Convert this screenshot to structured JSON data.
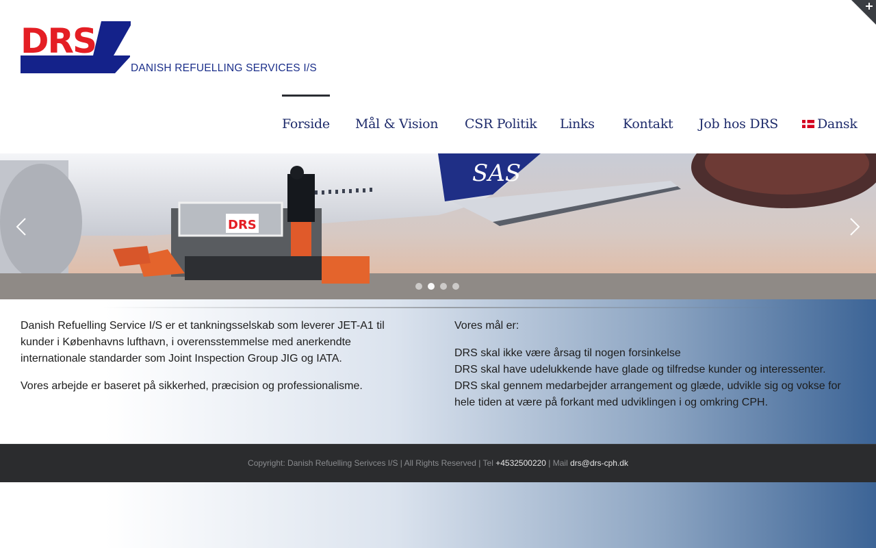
{
  "brand": {
    "logo_text": "DRS",
    "subtitle": "DANISH REFUELLING SERVICES I/S",
    "colors": {
      "red": "#e41e24",
      "navy": "#14228a"
    }
  },
  "nav": {
    "items": [
      {
        "label": "Forside",
        "active": true
      },
      {
        "label": "Mål & Vision"
      },
      {
        "label": "CSR Politik"
      },
      {
        "label": "Links"
      },
      {
        "label": "Kontakt"
      },
      {
        "label": "Job hos DRS"
      },
      {
        "label": "Dansk",
        "icon": "danish-flag-icon"
      }
    ]
  },
  "slider": {
    "image_text": "SAS",
    "truck_label": "DRS",
    "prev_icon": "chevron-left-icon",
    "next_icon": "chevron-right-icon",
    "slide_count": 4,
    "active_slide": 2
  },
  "content": {
    "left": {
      "p1": "Danish Refuelling Service I/S er et tankningsselskab  som leverer JET-A1 til kunder i Københavns lufthavn, i overensstemmelse med anerkendte internationale standarder som Joint Inspection Group JIG og IATA.",
      "p2": "Vores arbejde er baseret på sikkerhed, præcision og professionalisme."
    },
    "right": {
      "heading": "Vores mål er:",
      "line1": "DRS skal ikke være årsag til nogen forsinkelse",
      "line2": "DRS skal have udelukkende have glade og tilfredse kunder og interessenter.",
      "line3": "DRS skal gennem medarbejder arrangement og glæde, udvikle sig og vokse for hele tiden at være på forkant med udviklingen i og omkring CPH."
    }
  },
  "footer": {
    "copyright": "Copyright: Danish Refuelling Serivces I/S | All Rights Reserved | Tel ",
    "phone": "+4532500220",
    "mail_label": " | Mail ",
    "email": "drs@drs-cph.dk"
  },
  "corner_toggle_icon": "plus-icon"
}
